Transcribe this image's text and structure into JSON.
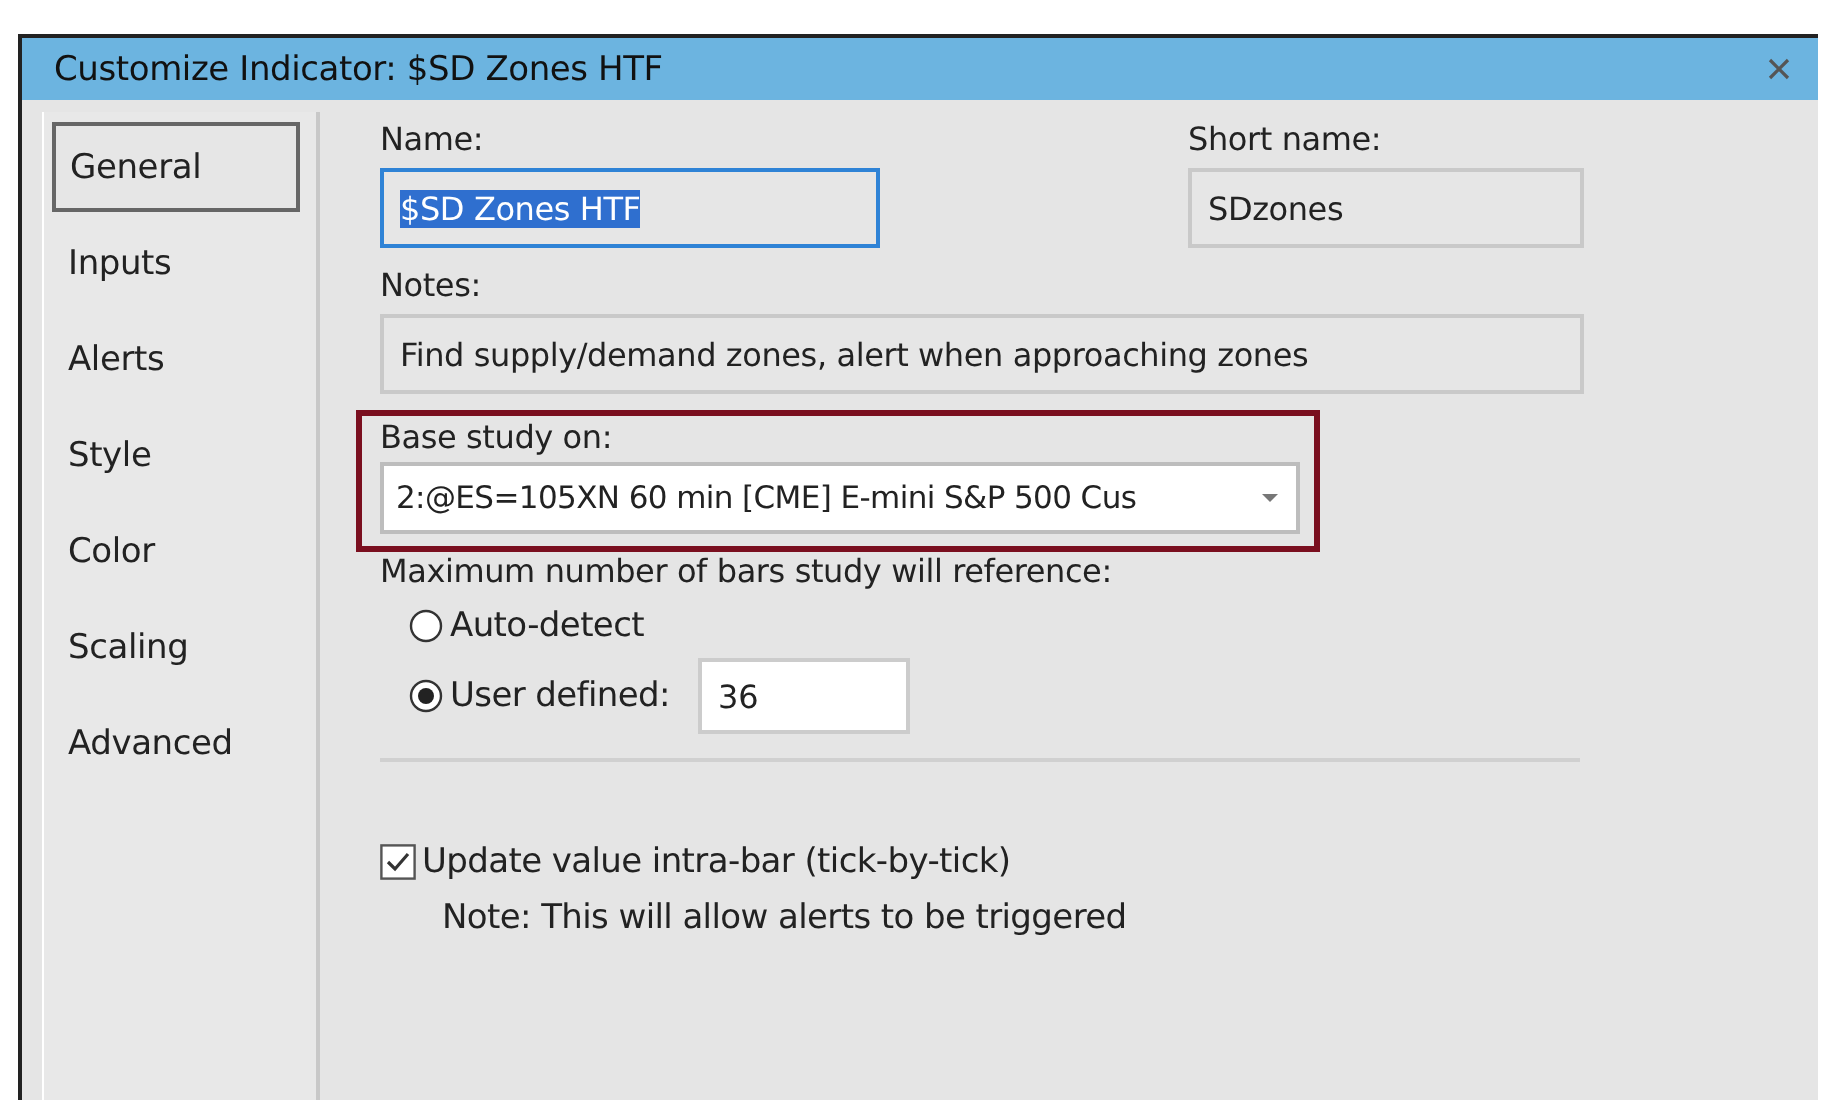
{
  "window": {
    "title": "Customize Indicator: $SD Zones HTF"
  },
  "sidebar": {
    "items": [
      {
        "label": "General",
        "selected": true
      },
      {
        "label": "Inputs",
        "selected": false
      },
      {
        "label": "Alerts",
        "selected": false
      },
      {
        "label": "Style",
        "selected": false
      },
      {
        "label": "Color",
        "selected": false
      },
      {
        "label": "Scaling",
        "selected": false
      },
      {
        "label": "Advanced",
        "selected": false
      }
    ]
  },
  "name": {
    "label": "Name:",
    "value": "$SD Zones HTF",
    "text_selected": true
  },
  "short_name": {
    "label": "Short name:",
    "value": "SDzones"
  },
  "notes": {
    "label": "Notes:",
    "value": "Find supply/demand zones, alert when approaching zones"
  },
  "base_study": {
    "label": "Base study on:",
    "value": "2:@ES=105XN 60 min [CME] E-mini S&P 500 Cus"
  },
  "max_bars": {
    "label": "Maximum number of bars study will reference:",
    "options": [
      {
        "label": "Auto-detect",
        "selected": false
      },
      {
        "label": "User defined:",
        "selected": true
      }
    ],
    "value": "36"
  },
  "intrabar": {
    "label": "Update value intra-bar (tick-by-tick)",
    "checked": true,
    "note": "Note: This will allow alerts to be triggered"
  }
}
